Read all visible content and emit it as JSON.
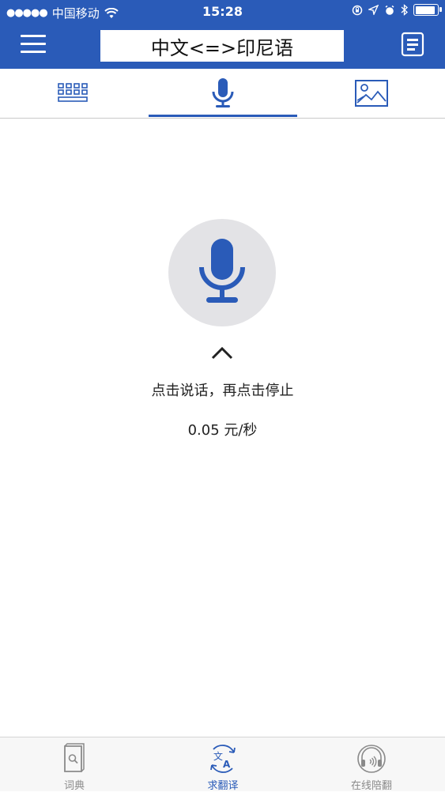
{
  "status_bar": {
    "carrier": "中国移动",
    "time": "15:28"
  },
  "header": {
    "title": "中文<=>印尼语",
    "menu_icon": "hamburger-menu-icon",
    "history_icon": "document-list-icon"
  },
  "input_tabs": [
    {
      "name": "keyboard",
      "icon": "keyboard-icon",
      "active": false
    },
    {
      "name": "voice",
      "icon": "microphone-icon",
      "active": true
    },
    {
      "name": "image",
      "icon": "image-icon",
      "active": false
    }
  ],
  "voice": {
    "hint": "点击说话，再点击停止",
    "price": "0.05 元/秒"
  },
  "bottom_nav": [
    {
      "label": "词典",
      "icon": "dictionary-book-icon",
      "active": false
    },
    {
      "label": "求翻译",
      "icon": "translate-icon",
      "active": true
    },
    {
      "label": "在线陪翻",
      "icon": "headset-icon",
      "active": false
    }
  ],
  "colors": {
    "brand_blue": "#2a5bb8",
    "mic_circle_bg": "#e3e3e6",
    "inactive_gray": "#8a8a8a"
  }
}
